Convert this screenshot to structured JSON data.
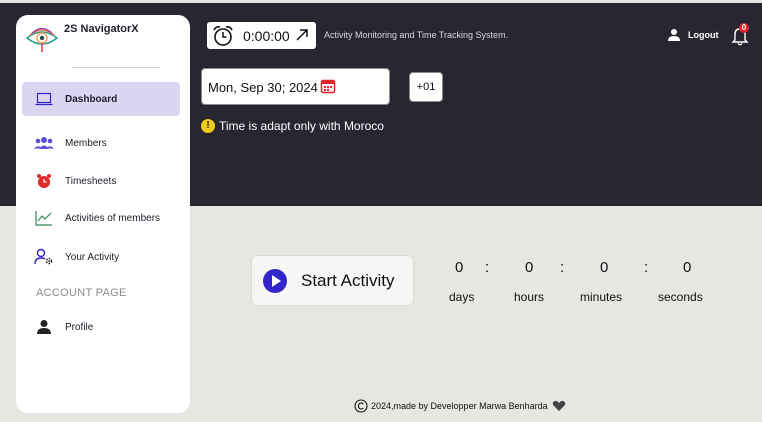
{
  "brand": {
    "name": "2S NavigatorX"
  },
  "sidebar": {
    "items": [
      {
        "label": "Dashboard",
        "icon": "laptop-icon",
        "active": true
      },
      {
        "label": "Members",
        "icon": "users-icon"
      },
      {
        "label": "Timesheets",
        "icon": "alarm-clock-icon"
      },
      {
        "label": "Activities of members",
        "icon": "line-chart-icon"
      },
      {
        "label": "Your Activity",
        "icon": "user-settings-icon"
      }
    ],
    "section_label": "ACCOUNT PAGE",
    "account_items": [
      {
        "label": "Profile",
        "icon": "person-icon"
      }
    ]
  },
  "header": {
    "timer": "0:00:00",
    "title": "Activity Monitoring and Time Tracking System.",
    "logout_label": "Logout",
    "notification_count": "0"
  },
  "date_field": {
    "value": "Mon, Sep 30; 2024"
  },
  "timezone_button": "+01",
  "notice": "Time is adapt only with Moroco",
  "activity": {
    "start_label": "Start Activity",
    "countdown": [
      {
        "value": "0",
        "unit": "days"
      },
      {
        "value": "0",
        "unit": "hours"
      },
      {
        "value": "0",
        "unit": "minutes"
      },
      {
        "value": "0",
        "unit": "seconds"
      }
    ],
    "separator": ":"
  },
  "footer": {
    "text": "2024,made by Developper Marwa Benharda"
  },
  "colors": {
    "header_bg": "#262730",
    "accent": "#3325c9",
    "active_nav_bg": "#dcd6f3",
    "badge": "#e5212b",
    "notice": "#f2cc1b"
  }
}
